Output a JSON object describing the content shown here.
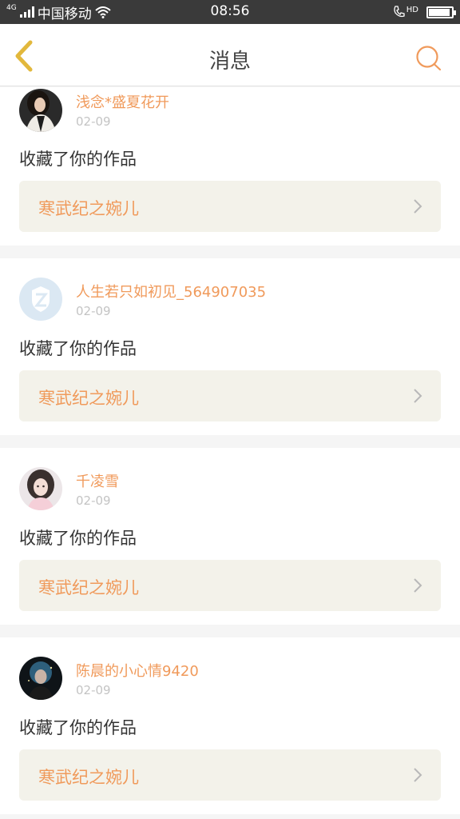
{
  "status_bar": {
    "network_tag": "4G",
    "carrier": "中国移动",
    "time": "08:56",
    "call_tag": "HD",
    "battery_level": 0.92,
    "icons": [
      "signal-icon",
      "wifi-icon",
      "hd-call-icon",
      "battery-icon"
    ]
  },
  "header": {
    "title": "消息",
    "back_icon": "chevron-left-icon",
    "search_icon": "search-icon"
  },
  "colors": {
    "accent": "#f09a5b",
    "back_arrow": "#e2b83c",
    "card_box": "#f3f2ea"
  },
  "messages": [
    {
      "username": "浅念*盛夏花开",
      "date": "02-09",
      "action": "收藏了你的作品",
      "work_title": "寒武纪之婉儿"
    },
    {
      "username": "人生若只如初见_564907035",
      "date": "02-09",
      "action": "收藏了你的作品",
      "work_title": "寒武纪之婉儿"
    },
    {
      "username": "千凌雪",
      "date": "02-09",
      "action": "收藏了你的作品",
      "work_title": "寒武纪之婉儿"
    },
    {
      "username": "陈晨的小心情9420",
      "date": "02-09",
      "action": "收藏了你的作品",
      "work_title": "寒武纪之婉儿"
    }
  ]
}
